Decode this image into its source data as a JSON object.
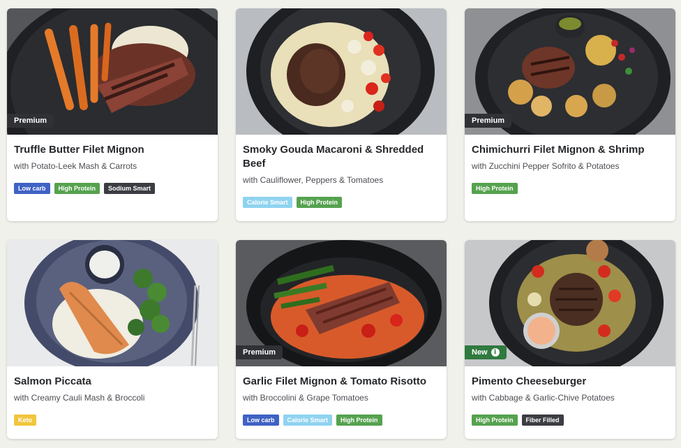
{
  "meals": [
    {
      "title": "Truffle Butter Filet Mignon",
      "subtitle": "with Potato-Leek Mash & Carrots",
      "ribbon": "Premium",
      "tags": [
        "Low carb",
        "High Protein",
        "Sodium Smart"
      ]
    },
    {
      "title": "Smoky Gouda Macaroni & Shredded Beef",
      "subtitle": "with Cauliflower, Peppers & Tomatoes",
      "ribbon": "",
      "tags": [
        "Calorie Smart",
        "High Protein"
      ]
    },
    {
      "title": "Chimichurri Filet Mignon & Shrimp",
      "subtitle": "with Zucchini Pepper Sofrito & Potatoes",
      "ribbon": "Premium",
      "tags": [
        "High Protein"
      ]
    },
    {
      "title": "Salmon Piccata",
      "subtitle": "with Creamy Cauli Mash & Broccoli",
      "ribbon": "",
      "tags": [
        "Keto"
      ]
    },
    {
      "title": "Garlic Filet Mignon & Tomato Risotto",
      "subtitle": "with Broccolini & Grape Tomatoes",
      "ribbon": "Premium",
      "tags": [
        "Low carb",
        "Calorie Smart",
        "High Protein"
      ]
    },
    {
      "title": "Pimento Cheeseburger",
      "subtitle": "with Cabbage & Garlic-Chive Potatoes",
      "ribbon": "New",
      "tags": [
        "High Protein",
        "Fiber Filled"
      ]
    }
  ],
  "colors": {
    "low_carb": "#3f63c5",
    "high_protein": "#55a24f",
    "sodium_smart": "#3b3d42",
    "calorie_smart": "#8fd3f0",
    "keto": "#f2c53d",
    "fiber_filled": "#3b3d42",
    "premium_ribbon": "#2f3135",
    "new_ribbon": "#2f7a3f"
  },
  "icons": {
    "new_ribbon": "info-icon"
  }
}
